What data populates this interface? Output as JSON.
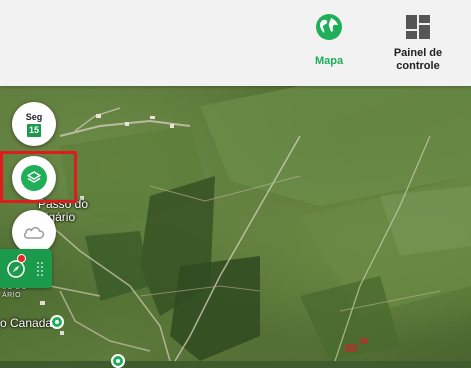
{
  "header": {
    "nav": [
      {
        "label": "Mapa",
        "icon": "globe-icon",
        "active": true
      },
      {
        "label": "Painel de controle",
        "icon": "dashboard-icon",
        "active": false
      }
    ]
  },
  "controls": {
    "date": {
      "day": "Seg",
      "number": "15"
    },
    "layers": {
      "icon": "layers-icon"
    },
    "weather": {
      "icon": "cloud-icon"
    },
    "compass": {
      "icon": "compass-icon"
    }
  },
  "map": {
    "labels": {
      "place_main_line1": "Passo do",
      "place_main_line2": "Vigário",
      "place_small": "SO DO",
      "place_small2": "ÁRIO",
      "place_canada": "o Canada"
    }
  },
  "colors": {
    "accent": "#1faf58",
    "panel_green": "#1a9a4a",
    "highlight": "#e11b1b",
    "header_bg": "#f2f2f2"
  }
}
